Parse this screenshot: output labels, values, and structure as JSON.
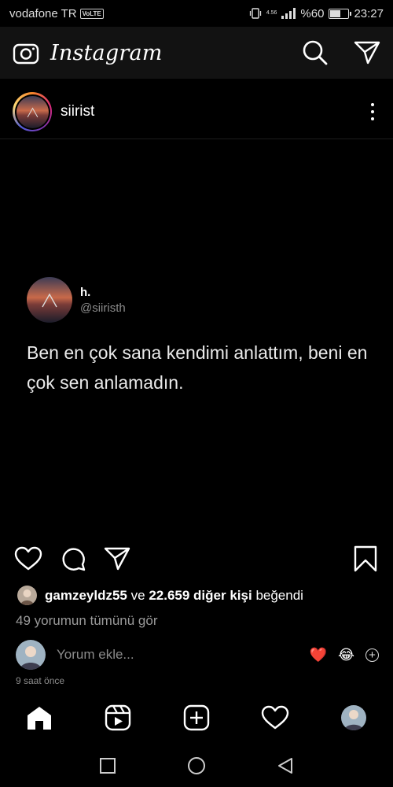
{
  "status_bar": {
    "carrier": "vodafone TR",
    "volte": "VoLTE",
    "network": "4.56",
    "battery_text": "%60",
    "battery_level": 0.6,
    "time": "23:27"
  },
  "app": {
    "logo": "Instagram",
    "icons": [
      "camera-icon",
      "search-icon",
      "direct-message-icon"
    ]
  },
  "post": {
    "username": "siirist",
    "tweet": {
      "name": "h.",
      "handle": "@siiristh",
      "text": "Ben en çok sana kendimi anlattım, beni en çok sen anlamadın."
    },
    "likes": {
      "user": "gamzeyldz55",
      "connector": "ve",
      "others": "22.659 diğer kişi",
      "suffix": "beğendi"
    },
    "view_comments": "49 yorumun tümünü gör",
    "comment_placeholder": "Yorum ekle...",
    "quick_reactions": [
      "❤️",
      "😂"
    ],
    "timestamp": "9 saat önce"
  },
  "bottom_nav": [
    "home-icon",
    "reels-icon",
    "new-post-icon",
    "activity-icon",
    "profile-avatar"
  ],
  "colors": {
    "background": "#000000",
    "topbar": "#121212",
    "secondary_text": "#8b8b8b",
    "like_red": "#e0245e"
  }
}
